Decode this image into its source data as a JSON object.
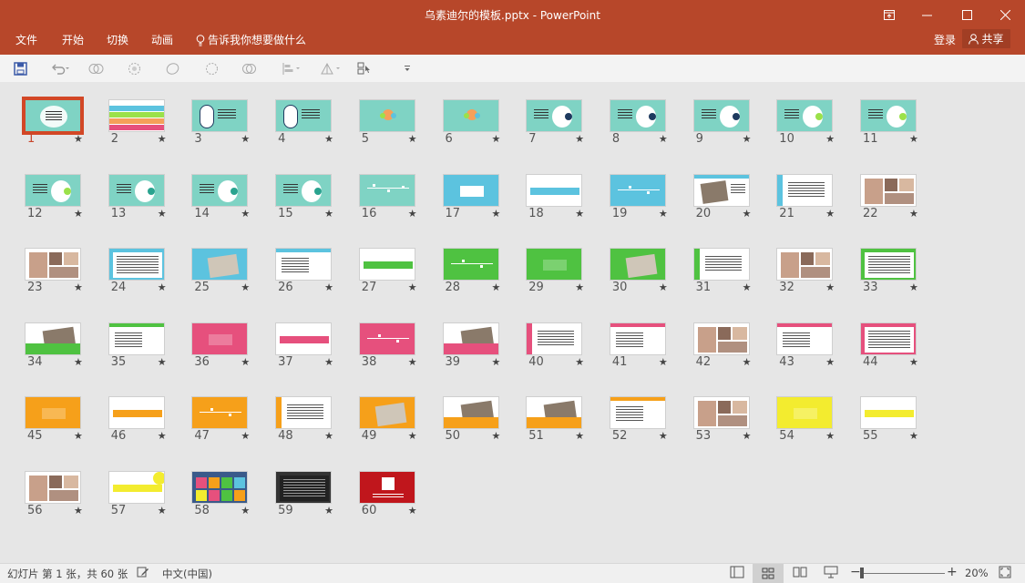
{
  "window": {
    "title": "乌素迪尔的模板.pptx - PowerPoint"
  },
  "menu": {
    "items": [
      "文件",
      "开始",
      "切换",
      "动画"
    ],
    "tellme": "告诉我你想要做什么",
    "login": "登录",
    "share": "共享"
  },
  "status": {
    "slide_info": "幻灯片 第 1 张，共 60 张",
    "language": "中文(中国)",
    "zoom": "20%"
  },
  "slides": [
    {
      "n": "1",
      "k": "teal-rings"
    },
    {
      "n": "2",
      "k": "stripes"
    },
    {
      "n": "3",
      "k": "teal-outline"
    },
    {
      "n": "4",
      "k": "teal-outline"
    },
    {
      "n": "5",
      "k": "teal-flower"
    },
    {
      "n": "6",
      "k": "teal-flower"
    },
    {
      "n": "7",
      "k": "teal-navy"
    },
    {
      "n": "8",
      "k": "teal-navy"
    },
    {
      "n": "9",
      "k": "teal-navy"
    },
    {
      "n": "10",
      "k": "teal-lime"
    },
    {
      "n": "11",
      "k": "teal-lime"
    },
    {
      "n": "12",
      "k": "teal-lime"
    },
    {
      "n": "13",
      "k": "teal-teal"
    },
    {
      "n": "14",
      "k": "teal-teal"
    },
    {
      "n": "15",
      "k": "teal-teal"
    },
    {
      "n": "16",
      "k": "teal-lines"
    },
    {
      "n": "17",
      "k": "blue-grid"
    },
    {
      "n": "18",
      "k": "white-bar-blue"
    },
    {
      "n": "19",
      "k": "blue-lines"
    },
    {
      "n": "20",
      "k": "white-photo-blue"
    },
    {
      "n": "21",
      "k": "white-list-blue"
    },
    {
      "n": "22",
      "k": "photo-collage"
    },
    {
      "n": "23",
      "k": "photo-collage"
    },
    {
      "n": "24",
      "k": "blue-text"
    },
    {
      "n": "25",
      "k": "blue-photo"
    },
    {
      "n": "26",
      "k": "white-text-blue"
    },
    {
      "n": "27",
      "k": "white-bar-green"
    },
    {
      "n": "28",
      "k": "green-lines"
    },
    {
      "n": "29",
      "k": "green-grid"
    },
    {
      "n": "30",
      "k": "green-photo"
    },
    {
      "n": "31",
      "k": "white-list-green"
    },
    {
      "n": "32",
      "k": "photo-collage"
    },
    {
      "n": "33",
      "k": "green-text"
    },
    {
      "n": "34",
      "k": "white-photo-green"
    },
    {
      "n": "35",
      "k": "white-text-green"
    },
    {
      "n": "36",
      "k": "pink-grid"
    },
    {
      "n": "37",
      "k": "white-bar-pink"
    },
    {
      "n": "38",
      "k": "pink-lines"
    },
    {
      "n": "39",
      "k": "white-photo-pink"
    },
    {
      "n": "40",
      "k": "white-list-pink"
    },
    {
      "n": "41",
      "k": "white-text-pink"
    },
    {
      "n": "42",
      "k": "photo-collage"
    },
    {
      "n": "43",
      "k": "white-text-pink"
    },
    {
      "n": "44",
      "k": "pink-text"
    },
    {
      "n": "45",
      "k": "orange-grid"
    },
    {
      "n": "46",
      "k": "white-bar-orange"
    },
    {
      "n": "47",
      "k": "orange-lines"
    },
    {
      "n": "48",
      "k": "white-list-orange"
    },
    {
      "n": "49",
      "k": "orange-photo"
    },
    {
      "n": "50",
      "k": "white-photo-orange"
    },
    {
      "n": "51",
      "k": "white-photo-orange"
    },
    {
      "n": "52",
      "k": "white-text-orange"
    },
    {
      "n": "53",
      "k": "photo-collage"
    },
    {
      "n": "54",
      "k": "yellow-grid"
    },
    {
      "n": "55",
      "k": "white-bar-yellow"
    },
    {
      "n": "56",
      "k": "photo-collage"
    },
    {
      "n": "57",
      "k": "white-bar-yellow2"
    },
    {
      "n": "58",
      "k": "colorful"
    },
    {
      "n": "59",
      "k": "dark"
    },
    {
      "n": "60",
      "k": "red"
    }
  ],
  "theme": {
    "red": "#b7472a",
    "share": "#a13e24",
    "teal": "#7fd3c4",
    "navy": "#1e3a5f",
    "lime": "#9be14a",
    "blue": "#5cc3df",
    "green": "#4fc241",
    "pink": "#e6507d",
    "orange": "#f6a01a",
    "yellow": "#f3ec2f",
    "selection": "#d24726"
  }
}
